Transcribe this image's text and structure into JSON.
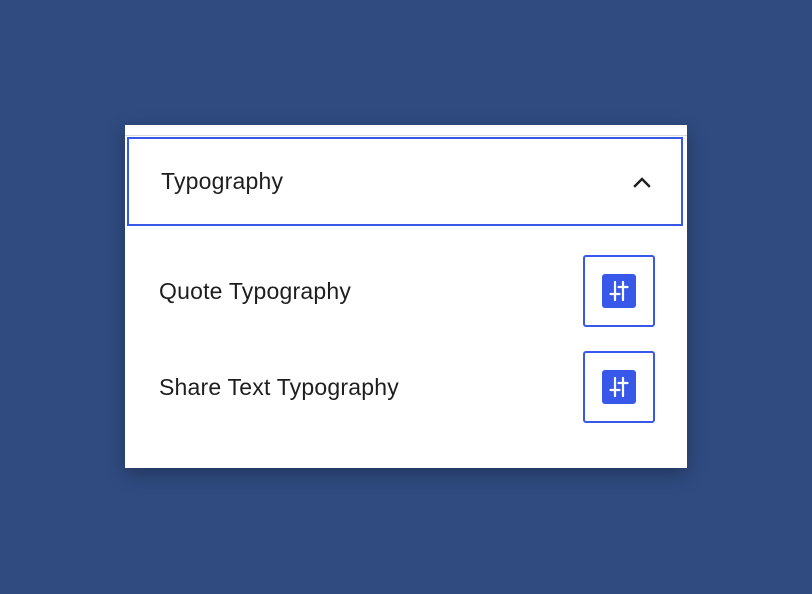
{
  "panel": {
    "section": {
      "title": "Typography",
      "expanded": true,
      "toggle_icon": "chevron-up-icon"
    },
    "rows": [
      {
        "label": "Quote Typography",
        "button_icon": "typography-settings-icon"
      },
      {
        "label": "Share Text Typography",
        "button_icon": "typography-settings-icon"
      }
    ]
  },
  "colors": {
    "background": "#2f4b80",
    "panel": "#ffffff",
    "accent": "#3858e9",
    "text": "#1e1e1e"
  }
}
